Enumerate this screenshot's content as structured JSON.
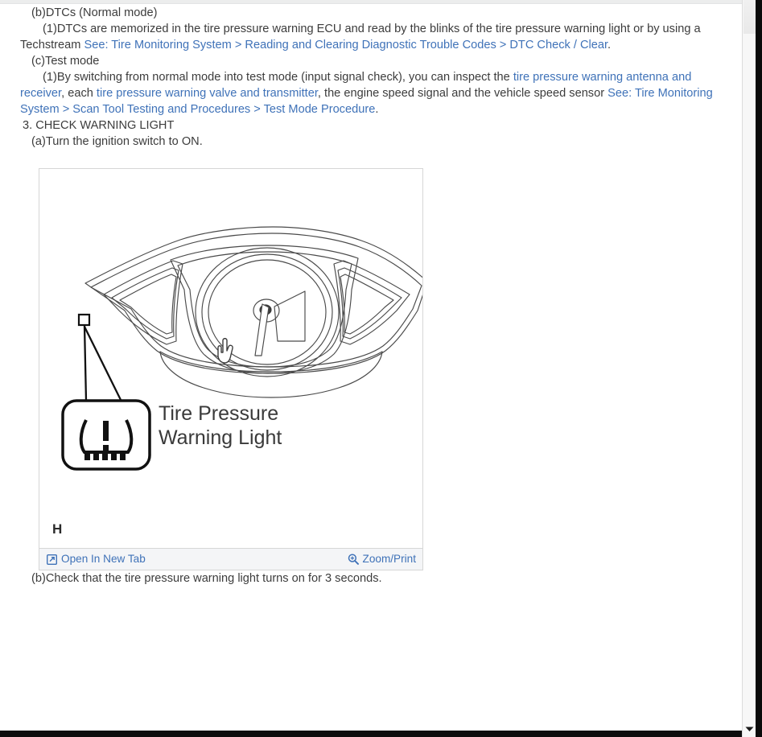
{
  "document": {
    "section_b": {
      "label": "(b)DTCs (Normal mode)",
      "item1_prefix": "(1)DTCs are memorized in the tire pressure warning ECU and read by the blinks of the tire pressure warning light or by using a Techstream ",
      "item1_link": "See: Tire Monitoring System > Reading and Clearing Diagnostic Trouble Codes > DTC Check / Clear",
      "item1_suffix": "."
    },
    "section_c": {
      "label": "(c)Test mode",
      "item1_p1": "(1)By switching from normal mode into test mode (input signal check), you can inspect the ",
      "item1_link1": "tire pressure warning antenna and receiver",
      "item1_p2": ", each ",
      "item1_link2": "tire pressure warning valve and transmitter",
      "item1_p3": ", the engine speed signal and the vehicle speed sensor ",
      "item1_link3": "See: Tire Monitoring System > Scan Tool Testing and Procedures > Test Mode Procedure",
      "item1_p4": "."
    },
    "section_3": {
      "heading": "3. CHECK WARNING LIGHT",
      "step_a": "(a)Turn the ignition switch to ON.",
      "step_b": "(b)Check that the tire pressure warning light turns on for 3 seconds."
    }
  },
  "figure": {
    "callout_label_line1": "Tire Pressure",
    "callout_label_line2": "Warning Light",
    "corner_mark": "H",
    "toolbar": {
      "open_new_tab_label": "Open In New Tab",
      "open_new_tab_icon": "open-in-new-tab-icon",
      "zoom_print_label": "Zoom/Print",
      "zoom_print_icon": "magnifier-plus-icon"
    },
    "cursor": "pointing-hand-cursor"
  },
  "colors": {
    "link": "#3f72b8",
    "text": "#3c3c3c",
    "toolbar_bg": "#f4f5f7",
    "panel_border": "#d6d6d6",
    "scroll_thumb": "#c2c2c2"
  },
  "scrollbars": {
    "inner_position_percent": 16,
    "outer_position_percent": 0,
    "down_arrow_icon": "chevron-down-icon"
  }
}
